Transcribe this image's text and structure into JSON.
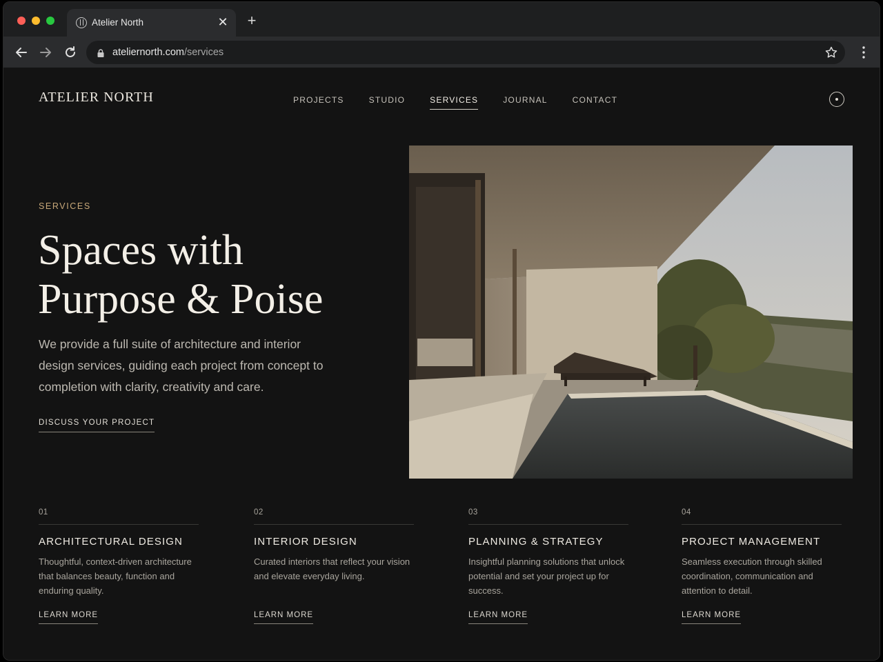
{
  "browser": {
    "tab_title": "Atelier North",
    "tab_close": "✕",
    "new_tab": "+",
    "url_domain": "ateliernorth.com",
    "url_path": "/services"
  },
  "site": {
    "logo": "ATELIER NORTH",
    "nav": [
      {
        "label": "PROJECTS"
      },
      {
        "label": "STUDIO"
      },
      {
        "label": "SERVICES",
        "active": true
      },
      {
        "label": "JOURNAL"
      },
      {
        "label": "CONTACT"
      }
    ]
  },
  "hero": {
    "eyebrow": "SERVICES",
    "title_line1": "Spaces with",
    "title_line2": "Purpose & Poise",
    "body": "We provide a full suite of architecture and interior design services, guiding each project from concept to completion with clarity, creativity and care.",
    "cta": "DISCUSS YOUR PROJECT"
  },
  "services": [
    {
      "num": "01",
      "title": "ARCHITECTURAL DESIGN",
      "desc": "Thoughtful, context-driven architecture that balances beauty, function and enduring quality.",
      "link": "LEARN MORE"
    },
    {
      "num": "02",
      "title": "INTERIOR DESIGN",
      "desc": "Curated interiors that reflect your vision and elevate everyday living.",
      "link": "LEARN MORE"
    },
    {
      "num": "03",
      "title": "PLANNING & STRATEGY",
      "desc": "Insightful planning solutions that unlock potential and set your project up for success.",
      "link": "LEARN MORE"
    },
    {
      "num": "04",
      "title": "PROJECT MANAGEMENT",
      "desc": "Seamless execution through skilled coordination, communication and attention to detail.",
      "link": "LEARN MORE"
    }
  ],
  "colors": {
    "accent": "#c9a97a",
    "background": "#131313",
    "text": "#f3efe7"
  }
}
